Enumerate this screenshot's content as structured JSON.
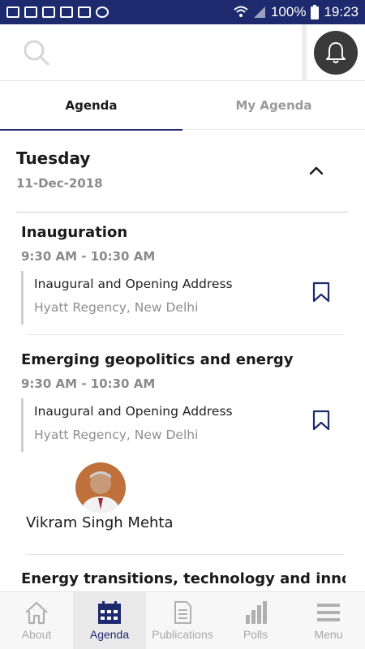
{
  "status_bar": {
    "battery": "100%",
    "time": "19:23"
  },
  "tabs": [
    {
      "label": "Agenda",
      "active": true
    },
    {
      "label": "My Agenda",
      "active": false
    }
  ],
  "day": {
    "title": "Tuesday",
    "date": "11-Dec-2018"
  },
  "sessions": [
    {
      "title": "Inauguration",
      "time": "9:30 AM - 10:30 AM",
      "detail_title": "Inaugural and Opening Address",
      "venue": "Hyatt Regency, New Delhi"
    },
    {
      "title": "Emerging geopolitics and energy",
      "time": "9:30 AM - 10:30 AM",
      "detail_title": "Inaugural and Opening Address",
      "venue": "Hyatt Regency, New Delhi",
      "speaker": "Vikram Singh Mehta"
    },
    {
      "title": "Energy transitions, technology and innovation"
    }
  ],
  "bottom_nav": [
    {
      "label": "About",
      "icon": "home-icon"
    },
    {
      "label": "Agenda",
      "icon": "calendar-icon",
      "active": true
    },
    {
      "label": "Publications",
      "icon": "document-icon"
    },
    {
      "label": "Polls",
      "icon": "bar-chart-icon"
    },
    {
      "label": "Menu",
      "icon": "hamburger-icon"
    }
  ],
  "colors": {
    "brand": "#1d2a6e",
    "muted": "#8a8a8a",
    "active_nav_bg": "#e9e9e9"
  }
}
